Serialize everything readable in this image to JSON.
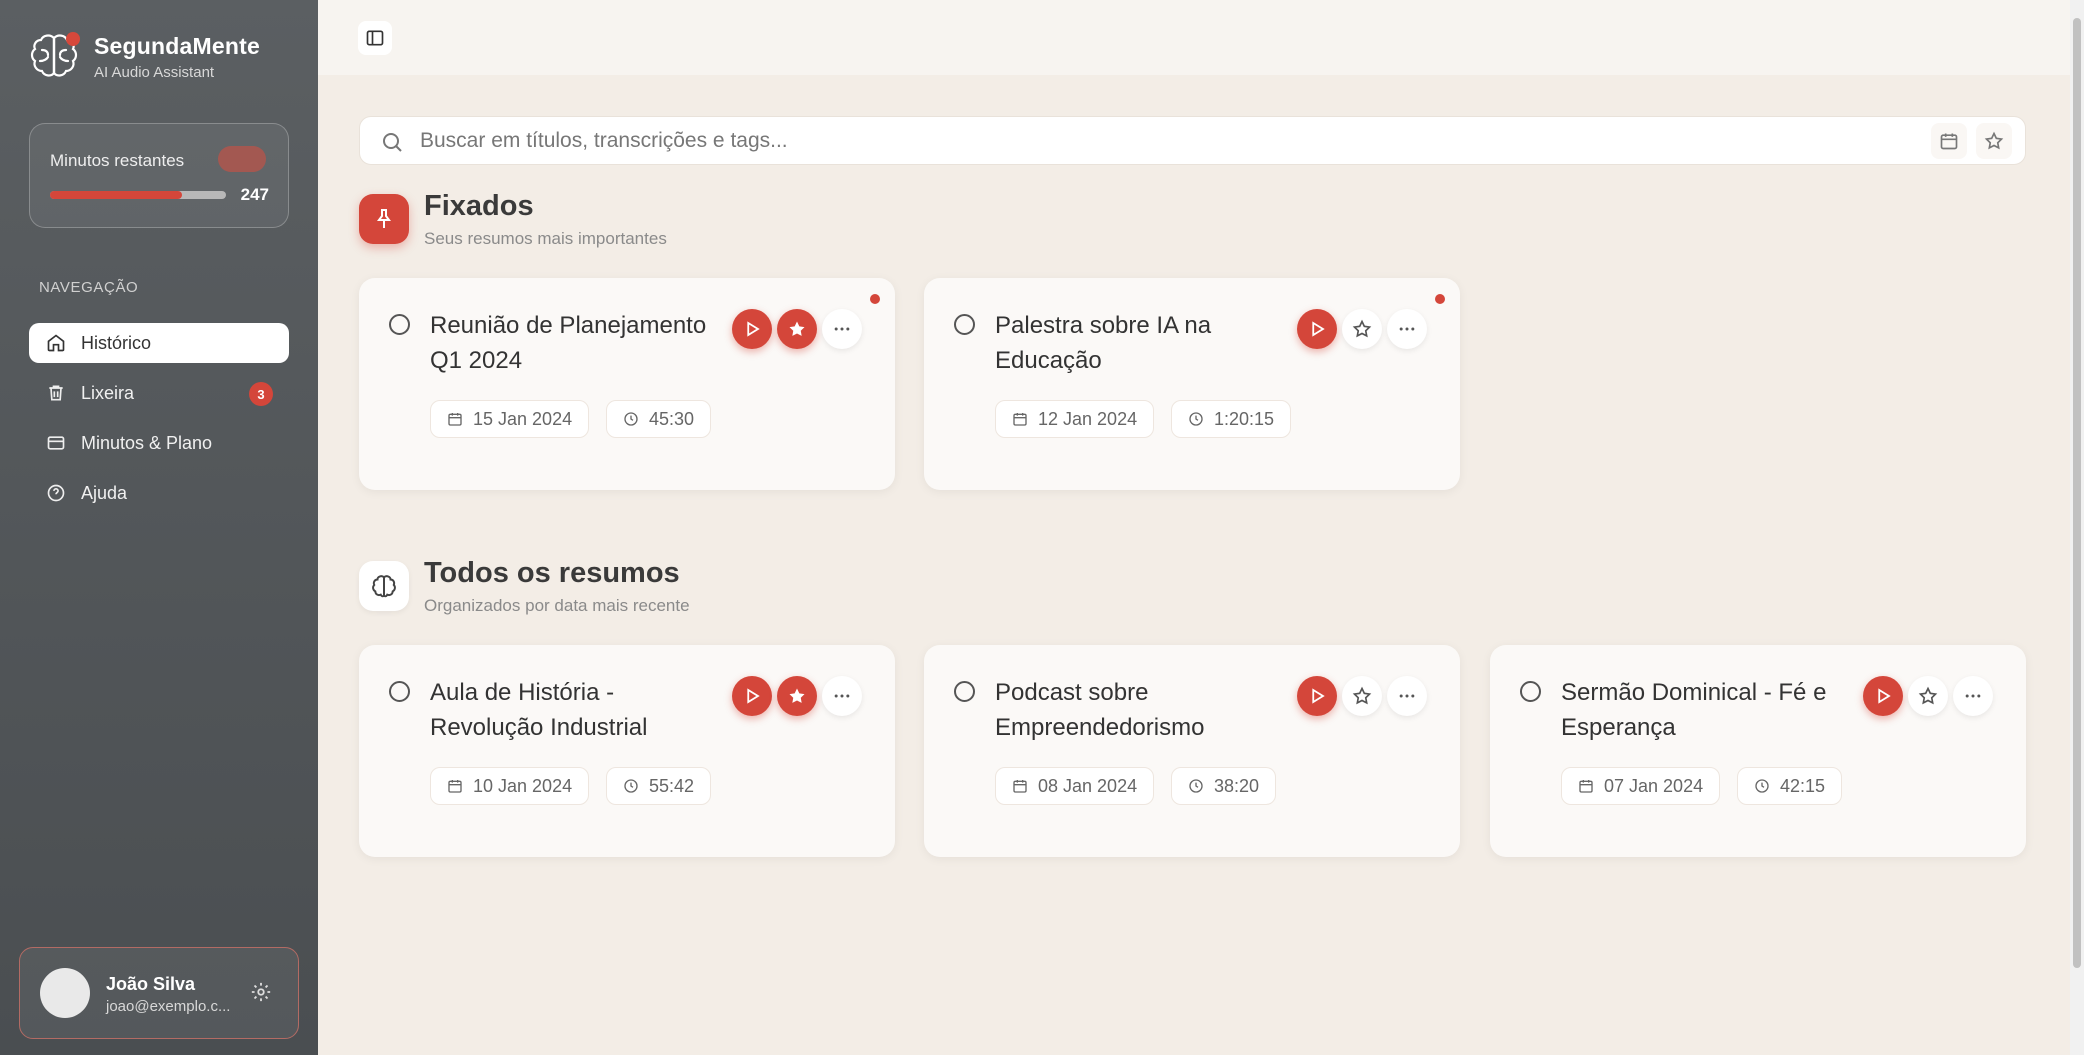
{
  "brand": {
    "name": "SegundaMente",
    "subtitle": "AI Audio Assistant"
  },
  "minutes": {
    "label": "Minutos restantes",
    "remaining": "247",
    "fill_fraction": 0.75
  },
  "nav": {
    "heading": "NAVEGAÇÃO",
    "items": [
      {
        "label": "Histórico",
        "icon": "home-icon",
        "active": true
      },
      {
        "label": "Lixeira",
        "icon": "trash-icon",
        "badge": "3"
      },
      {
        "label": "Minutos & Plano",
        "icon": "credit-card-icon"
      },
      {
        "label": "Ajuda",
        "icon": "help-circle-icon"
      }
    ]
  },
  "user": {
    "name": "João Silva",
    "email": "joao@exemplo.c..."
  },
  "search": {
    "placeholder": "Buscar em títulos, transcrições e tags..."
  },
  "pinned": {
    "title": "Fixados",
    "subtitle": "Seus resumos mais importantes",
    "cards": [
      {
        "title": "Reunião de Planejamento Q1 2024",
        "date": "15 Jan 2024",
        "duration": "45:30",
        "starred": true,
        "new": true
      },
      {
        "title": "Palestra sobre IA na Educação",
        "date": "12 Jan 2024",
        "duration": "1:20:15",
        "starred": false,
        "new": true
      }
    ]
  },
  "all": {
    "title": "Todos os resumos",
    "subtitle": "Organizados por data mais recente",
    "cards": [
      {
        "title": "Aula de História - Revolução Industrial",
        "date": "10 Jan 2024",
        "duration": "55:42",
        "starred": true
      },
      {
        "title": "Podcast sobre Empreendedorismo",
        "date": "08 Jan 2024",
        "duration": "38:20",
        "starred": false
      },
      {
        "title": "Sermão Dominical - Fé e Esperança",
        "date": "07 Jan 2024",
        "duration": "42:15",
        "starred": false
      }
    ]
  },
  "colors": {
    "accent": "#d4463a",
    "sidebar": "#525659",
    "background": "#f3ede6"
  }
}
